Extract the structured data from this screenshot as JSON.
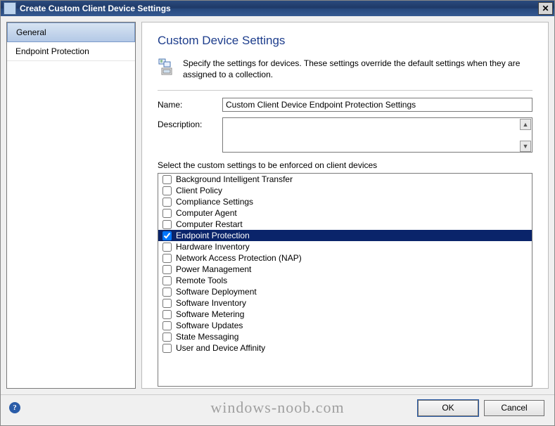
{
  "window": {
    "title": "Create Custom Client Device Settings"
  },
  "sidebar": {
    "items": [
      {
        "label": "General",
        "selected": true
      },
      {
        "label": "Endpoint Protection",
        "selected": false
      }
    ]
  },
  "page": {
    "heading": "Custom Device Settings",
    "intro": "Specify the settings for devices. These settings override the default settings when they are assigned to a collection.",
    "name_label": "Name:",
    "name_value": "Custom Client Device Endpoint Protection Settings",
    "description_label": "Description:",
    "description_value": "",
    "list_label": "Select the custom settings to be enforced on client devices",
    "settings": [
      {
        "label": "Background Intelligent Transfer",
        "checked": false,
        "selected": false
      },
      {
        "label": "Client Policy",
        "checked": false,
        "selected": false
      },
      {
        "label": "Compliance Settings",
        "checked": false,
        "selected": false
      },
      {
        "label": "Computer Agent",
        "checked": false,
        "selected": false
      },
      {
        "label": "Computer Restart",
        "checked": false,
        "selected": false
      },
      {
        "label": "Endpoint Protection",
        "checked": true,
        "selected": true
      },
      {
        "label": "Hardware Inventory",
        "checked": false,
        "selected": false
      },
      {
        "label": "Network Access Protection (NAP)",
        "checked": false,
        "selected": false
      },
      {
        "label": "Power Management",
        "checked": false,
        "selected": false
      },
      {
        "label": "Remote Tools",
        "checked": false,
        "selected": false
      },
      {
        "label": "Software Deployment",
        "checked": false,
        "selected": false
      },
      {
        "label": "Software Inventory",
        "checked": false,
        "selected": false
      },
      {
        "label": "Software Metering",
        "checked": false,
        "selected": false
      },
      {
        "label": "Software Updates",
        "checked": false,
        "selected": false
      },
      {
        "label": "State Messaging",
        "checked": false,
        "selected": false
      },
      {
        "label": "User and Device Affinity",
        "checked": false,
        "selected": false
      }
    ]
  },
  "footer": {
    "ok_label": "OK",
    "cancel_label": "Cancel",
    "watermark": "windows-noob.com",
    "help_glyph": "?"
  }
}
